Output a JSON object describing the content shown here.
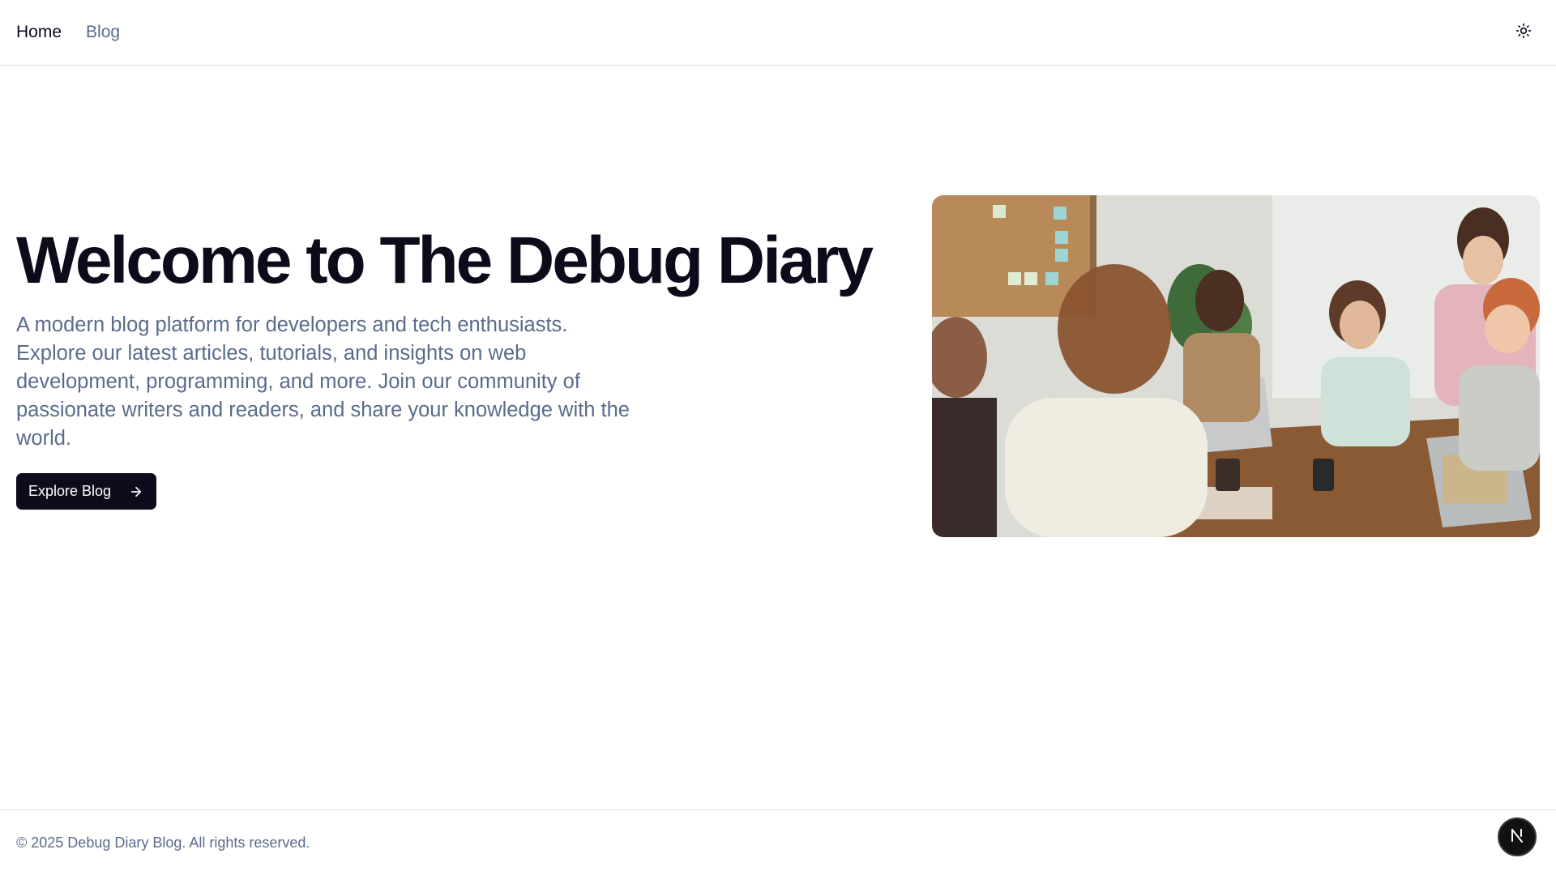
{
  "nav": {
    "home_label": "Home",
    "blog_label": "Blog"
  },
  "hero": {
    "title": "Welcome to The Debug Diary",
    "description": "A modern blog platform for developers and tech enthusiasts. Explore our latest articles, tutorials, and insights on web development, programming, and more. Join our community of passionate writers and readers, and share your knowledge with the world.",
    "cta_label": "Explore Blog",
    "image_alt": "Team collaborating around a table with laptops"
  },
  "footer": {
    "copyright": "© 2025 Debug Diary Blog. All rights reserved."
  },
  "icons": {
    "theme_toggle": "sun-icon",
    "cta_arrow": "arrow-right-icon",
    "dev_badge": "n-icon"
  },
  "colors": {
    "primary": "#0c0c1d",
    "muted_text": "#5b6b8c",
    "border": "#e5e7eb",
    "background": "#ffffff"
  }
}
